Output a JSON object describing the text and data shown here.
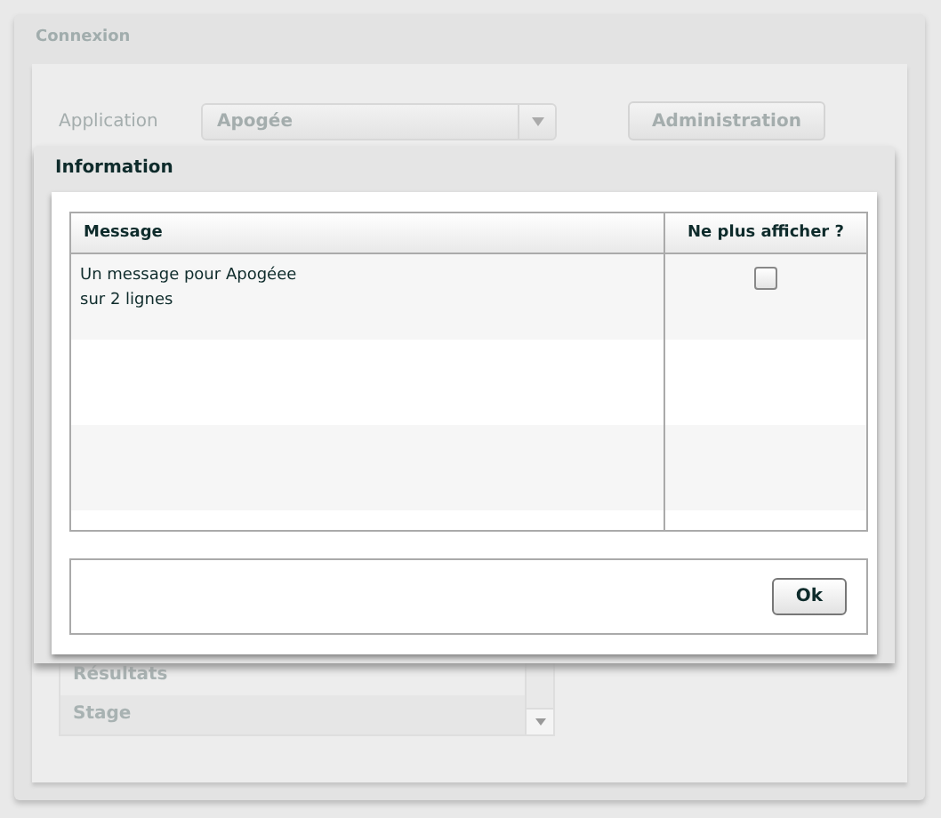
{
  "background": {
    "title": "Connexion",
    "application_label": "Application",
    "application_value": "Apogée",
    "admin_button": "Administration",
    "list_items": [
      "Résultats",
      "Stage"
    ]
  },
  "dialog": {
    "title": "Information",
    "columns": [
      "Message",
      "Ne plus afficher ?"
    ],
    "rows": [
      {
        "message": "Un message pour Apogéee\nsur 2 lignes",
        "hide": false
      }
    ],
    "ok_button": "Ok"
  }
}
